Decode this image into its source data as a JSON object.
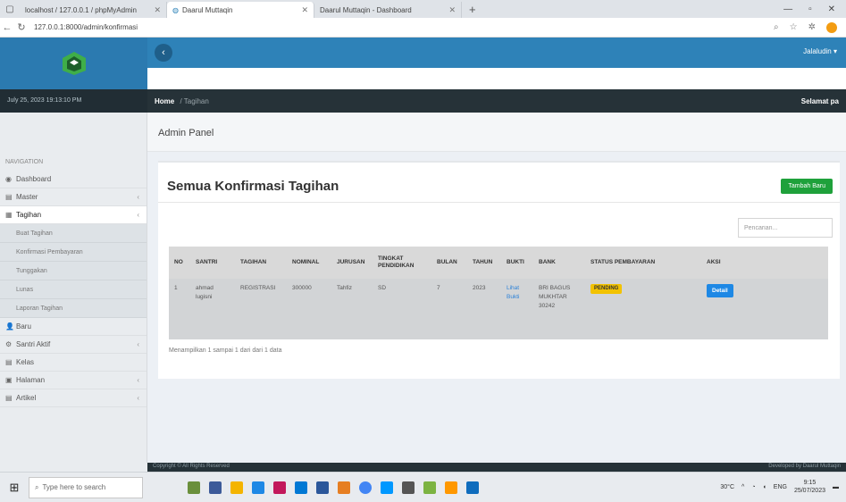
{
  "browser": {
    "tabs": [
      {
        "label": "localhost / 127.0.0.1 / phpMyAdmin",
        "active": false
      },
      {
        "label": "Daarul Muttaqin",
        "active": true
      },
      {
        "label": "Daarul Muttaqin - Dashboard",
        "active": false
      }
    ],
    "url": "127.0.0.1:8000/admin/konfirmasi"
  },
  "header": {
    "user_label": "Jalaludin ▾",
    "date_text": "July 25, 2023 19:13:10 PM",
    "breadcrumb_home": "Home",
    "breadcrumb_sub": "/ Tagihan",
    "right_link": "Selamat pa"
  },
  "sidebar": {
    "section_label": "NAVIGATION",
    "items": [
      {
        "icon": "◉",
        "label": "Dashboard",
        "chevron": false
      },
      {
        "icon": "▤",
        "label": "Master",
        "chevron": true
      },
      {
        "icon": "▦",
        "label": "Tagihan",
        "chevron": true,
        "open": true
      }
    ],
    "sub_items": [
      "Buat Tagihan",
      "Konfirmasi Pembayaran",
      "Tunggakan",
      "Lunas",
      "Laporan Tagihan"
    ],
    "more_items": [
      {
        "icon": "👤",
        "label": "Baru",
        "chevron": false
      },
      {
        "icon": "⚙",
        "label": "Santri Aktif",
        "chevron": true
      },
      {
        "icon": "▤",
        "label": "Kelas",
        "chevron": false
      },
      {
        "icon": "▣",
        "label": "Halaman",
        "chevron": true
      },
      {
        "icon": "▤",
        "label": "Artikel",
        "chevron": true
      }
    ]
  },
  "main": {
    "page_header": "Admin Panel",
    "card_title": "Semua Konfirmasi Tagihan",
    "add_button": "Tambah Baru",
    "search_placeholder": "Pencarian...",
    "table": {
      "headers": [
        "NO",
        "SANTRI",
        "TAGIHAN",
        "NOMINAL",
        "JURUSAN",
        "TINGKAT PENDIDIKAN",
        "BULAN",
        "TAHUN",
        "BUKTI",
        "BANK",
        "STATUS PEMBAYARAN",
        "AKSI"
      ],
      "rows": [
        {
          "no": "1",
          "santri": "ahmad lugisni",
          "tagihan": "REGISTRASI",
          "nominal": "300000",
          "jurusan": "Tahfiz",
          "tingkat": "SD",
          "bulan": "7",
          "tahun": "2023",
          "bukti": "Lihat Bukti",
          "bank": "BRI BAGUS MUKHTAR 30242",
          "status": "PENDING",
          "aksi": "Detail"
        }
      ]
    },
    "table_info": "Menampilkan 1 sampai 1 dari dari 1 data"
  },
  "footer": {
    "left": "Copyright © All Rights Reserved",
    "right": "Developed by Daarul Muttaqin"
  },
  "taskbar": {
    "search_placeholder": "Type here to search",
    "weather": "30°C",
    "time": "9:15",
    "date": "25/07/2023",
    "lang": "ENG"
  },
  "colors": {
    "brand": "#2e82b8",
    "dark_bar": "#263238",
    "success": "#1fa13b",
    "primary": "#1e88e5",
    "warning": "#f2c200"
  }
}
